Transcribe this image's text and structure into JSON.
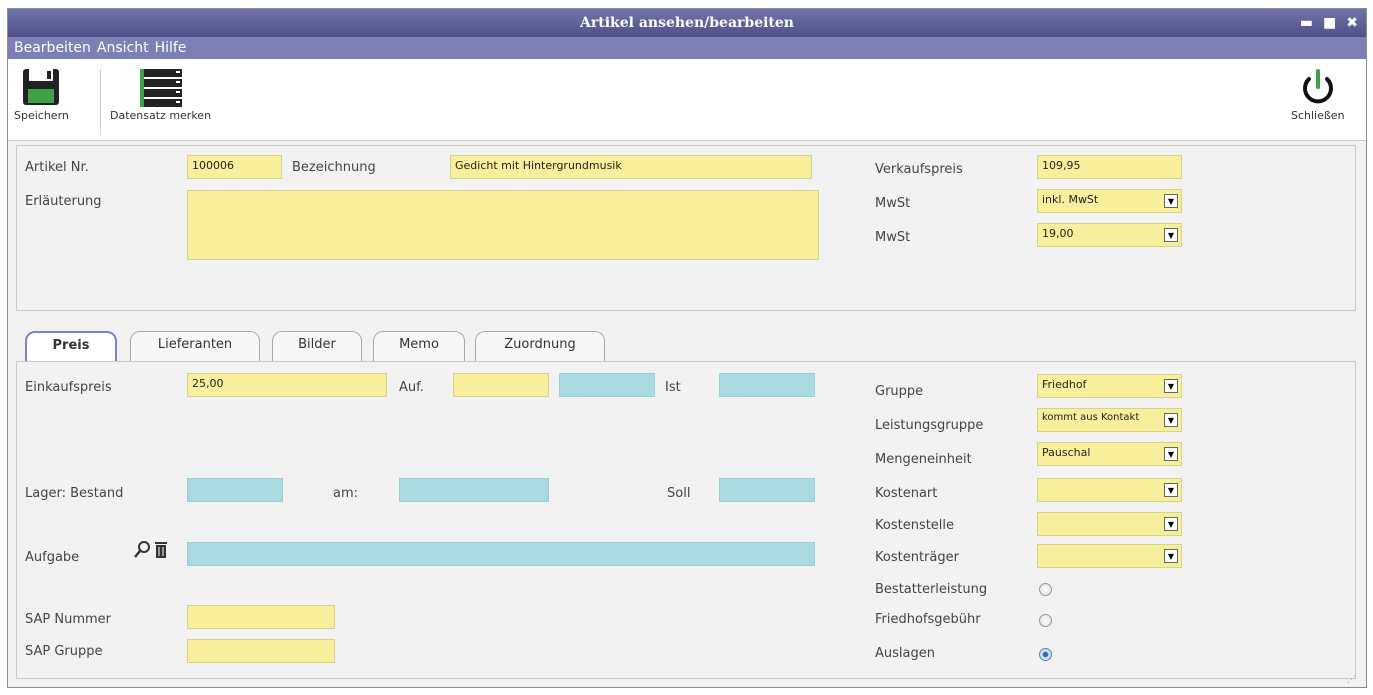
{
  "window": {
    "title": "Artikel ansehen/bearbeiten",
    "controls": {
      "minimize": "▬",
      "maximize": "■",
      "close": "✖"
    }
  },
  "menu": [
    "Bearbeiten",
    "Ansicht",
    "Hilfe"
  ],
  "toolbar": {
    "save_label": "Speichern",
    "bookmark_label": "Datensatz merken",
    "close_label": "Schließen"
  },
  "header_form": {
    "artikel_nr_label": "Artikel Nr.",
    "artikel_nr_value": "100006",
    "bezeichnung_label": "Bezeichnung",
    "bezeichnung_value": "Gedicht mit Hintergrundmusik",
    "erlaeuterung_label": "Erläuterung",
    "erlaeuterung_value": "",
    "verkaufspreis_label": "Verkaufspreis",
    "verkaufspreis_value": "109,95",
    "mwst_label_1": "MwSt",
    "mwst_value_1": "inkl. MwSt",
    "mwst_label_2": "MwSt",
    "mwst_value_2": "19,00"
  },
  "tabs": [
    "Preis",
    "Lieferanten",
    "Bilder",
    "Memo",
    "Zuordnung"
  ],
  "preis_tab": {
    "einkaufspreis_label": "Einkaufspreis",
    "einkaufspreis_value": "25,00",
    "auf_label": "Auf.",
    "auf_value": "",
    "auf_value2": "",
    "ist_label": "Ist",
    "ist_value": "",
    "lager_label": "Lager: Bestand",
    "lager_value": "",
    "am_label": "am:",
    "am_value": "",
    "soll_label": "Soll",
    "soll_value": "",
    "aufgabe_label": "Aufgabe",
    "aufgabe_value": "",
    "sap_nummer_label": "SAP Nummer",
    "sap_nummer_value": "",
    "sap_gruppe_label": "SAP Gruppe",
    "sap_gruppe_value": "",
    "gruppe_label": "Gruppe",
    "gruppe_value": "Friedhof",
    "leistungsgruppe_label": "Leistungsgruppe",
    "leistungsgruppe_value": "kommt aus Kontakt",
    "mengeneinheit_label": "Mengeneinheit",
    "mengeneinheit_value": "Pauschal",
    "kostenart_label": "Kostenart",
    "kostenart_value": "",
    "kostenstelle_label": "Kostenstelle",
    "kostenstelle_value": "",
    "kostentraeger_label": "Kostenträger",
    "kostentraeger_value": "",
    "bestatterleistung_label": "Bestatterleistung",
    "friedhofsgebuehr_label": "Friedhofsgebühr",
    "auslagen_label": "Auslagen",
    "selected_radio": "Auslagen"
  },
  "colors": {
    "titlebar": "#5a5e95",
    "menubar": "#7c80b4",
    "input_yellow": "#f7ef9b",
    "input_blue": "#a8dae0"
  }
}
